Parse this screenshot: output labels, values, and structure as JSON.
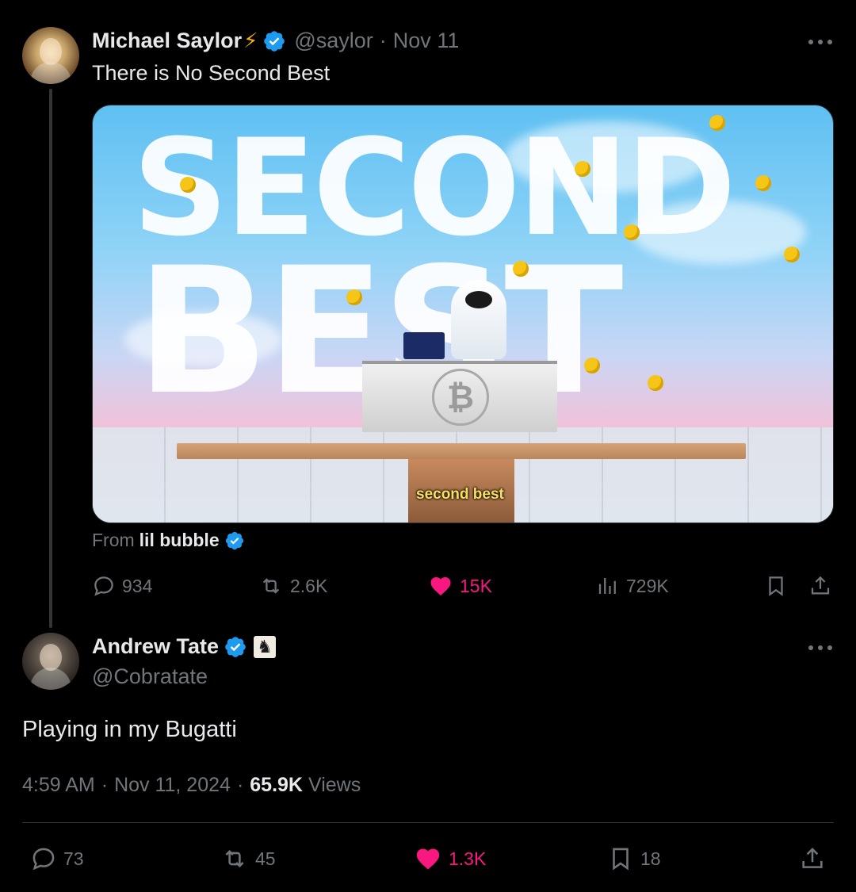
{
  "colors": {
    "background": "#000000",
    "text": "#e7e9ea",
    "muted": "#71767b",
    "verified": "#1d9bf0",
    "like": "#f91880"
  },
  "tweet1": {
    "name": "Michael Saylor",
    "name_emoji": "⚡",
    "handle": "@saylor",
    "separator": "·",
    "date": "Nov 11",
    "text": "There is No Second Best",
    "media": {
      "word_top": "SECOND",
      "word_bottom": "BEST",
      "desk_logo": "₿",
      "caption": "second best"
    },
    "from_label": "From",
    "from_source": "lil bubble",
    "stats": {
      "replies": "934",
      "reposts": "2.6K",
      "likes": "15K",
      "views": "729K"
    }
  },
  "tweet2": {
    "name": "Andrew Tate",
    "name_emoji": "♞",
    "handle": "@Cobratate",
    "text": "Playing in my Bugatti",
    "time": "4:59 AM",
    "separator1": "·",
    "date": "Nov 11, 2024",
    "separator2": "·",
    "views_count": "65.9K",
    "views_label": "Views",
    "stats": {
      "replies": "73",
      "reposts": "45",
      "likes": "1.3K",
      "bookmarks": "18"
    }
  },
  "icons": [
    "verified-badge-icon",
    "more-icon",
    "reply-icon",
    "repost-icon",
    "like-icon",
    "views-icon",
    "bookmark-icon",
    "share-icon"
  ]
}
